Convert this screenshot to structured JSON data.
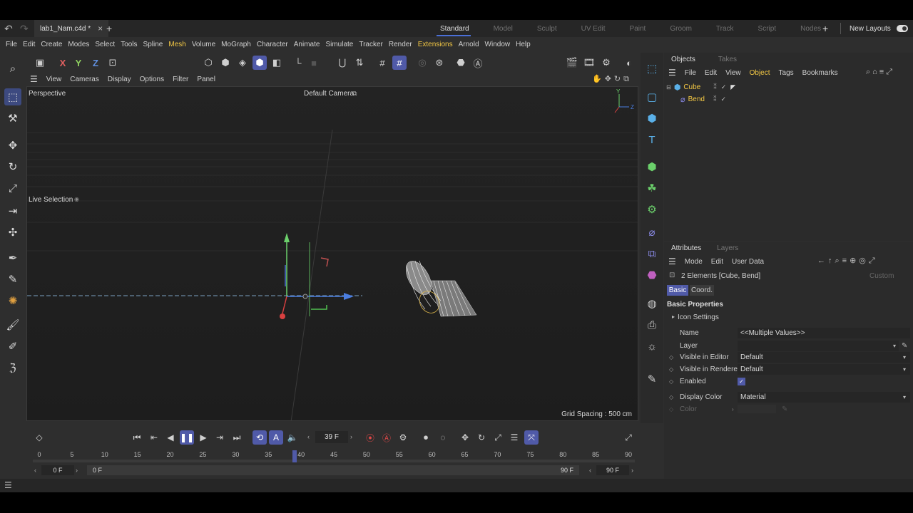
{
  "titlebar": {
    "file_tab": "lab1_Nam.c4d *",
    "close": "×",
    "add": "+",
    "layouts": [
      "Standard",
      "Model",
      "Sculpt",
      "UV Edit",
      "Paint",
      "Groom",
      "Track",
      "Script",
      "Nodes"
    ],
    "active_layout": "Standard",
    "new_layouts": "New Layouts"
  },
  "menubar": [
    "File",
    "Edit",
    "Create",
    "Modes",
    "Select",
    "Tools",
    "Spline",
    "Mesh",
    "Volume",
    "MoGraph",
    "Character",
    "Animate",
    "Simulate",
    "Tracker",
    "Render",
    "Extensions",
    "Arnold",
    "Window",
    "Help"
  ],
  "viewport": {
    "menu": [
      "View",
      "Cameras",
      "Display",
      "Options",
      "Filter",
      "Panel"
    ],
    "view_name": "Perspective",
    "camera": "Default Camera",
    "tool_label": "Live Selection",
    "grid_spacing": "Grid Spacing : 500 cm",
    "axis_y": "Y",
    "axis_z": "Z"
  },
  "objects_panel": {
    "tabs": [
      "Objects",
      "Takes"
    ],
    "menu": [
      "File",
      "Edit",
      "View",
      "Object",
      "Tags",
      "Bookmarks"
    ],
    "items": [
      {
        "name": "Cube",
        "icon": "cube-icon"
      },
      {
        "name": "Bend",
        "icon": "bend-deformer-icon"
      }
    ]
  },
  "attributes_panel": {
    "tabs": [
      "Attributes",
      "Layers"
    ],
    "menu": [
      "Mode",
      "Edit",
      "User Data"
    ],
    "selection": "2 Elements [Cube, Bend]",
    "custom": "Custom",
    "subtabs": [
      "Basic",
      "Coord."
    ],
    "section": "Basic Properties",
    "icon_settings": "Icon Settings",
    "fields": {
      "name_label": "Name",
      "name_value": "<<Multiple Values>>",
      "layer_label": "Layer",
      "layer_value": "",
      "vis_editor_label": "Visible in Editor",
      "vis_editor_value": "Default",
      "vis_render_label": "Visible in Renderer",
      "vis_render_value": "Default",
      "enabled_label": "Enabled",
      "display_color_label": "Display Color",
      "display_color_value": "Material",
      "color_label": "Color"
    }
  },
  "timeline": {
    "current_frame": "39 F",
    "start_frame": "0 F",
    "start_frame2": "0 F",
    "end_frame": "90 F",
    "end_frame2": "90 F",
    "ruler": [
      "0",
      "5",
      "10",
      "15",
      "20",
      "25",
      "30",
      "35",
      "40",
      "45",
      "50",
      "55",
      "60",
      "65",
      "70",
      "75",
      "80",
      "85",
      "90"
    ],
    "playhead_frame": 39
  },
  "colors": {
    "accent": "#505aa8",
    "highlight_menu": "#f2c744",
    "cube_label": "#f2c744",
    "bend_label": "#f2c744"
  }
}
